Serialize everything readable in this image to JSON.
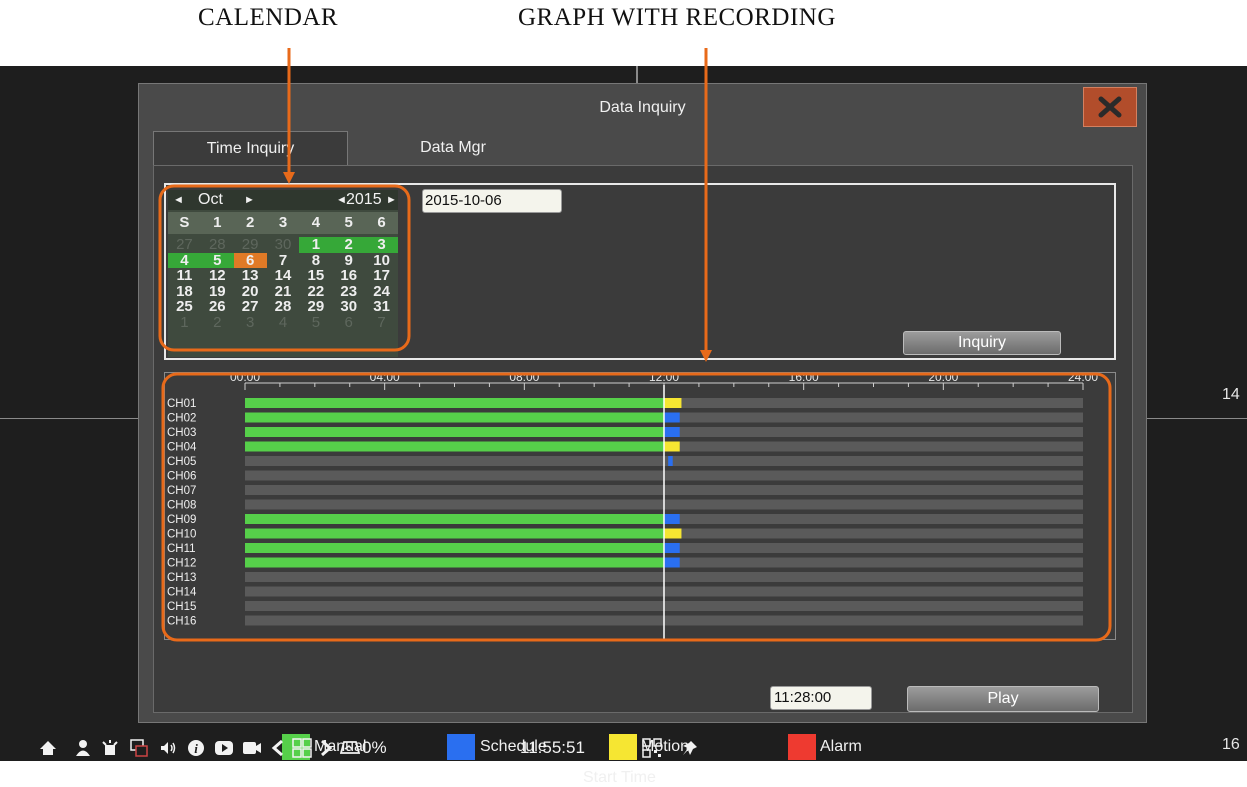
{
  "annotations": {
    "calendar": "CALENDAR",
    "graph": "GRAPH WITH RECORDING"
  },
  "side_numbers": {
    "right_mid": "14",
    "right_bottom": "16"
  },
  "dialog": {
    "title": "Data Inquiry",
    "tabs": [
      {
        "label": "Time Inquiry",
        "active": true
      },
      {
        "label": "Data Mgr",
        "active": false
      }
    ],
    "date_value": "2015-10-06",
    "inquiry_label": "Inquiry",
    "calendar": {
      "month": "Oct",
      "year": "2015",
      "weekdays": [
        "S",
        "1",
        "2",
        "3",
        "4",
        "5",
        "6"
      ],
      "weeks": [
        [
          {
            "d": "27",
            "s": "other"
          },
          {
            "d": "28",
            "s": "other"
          },
          {
            "d": "29",
            "s": "other"
          },
          {
            "d": "30",
            "s": "other"
          },
          {
            "d": "1",
            "s": "rec"
          },
          {
            "d": "2",
            "s": "rec"
          },
          {
            "d": "3",
            "s": "rec"
          }
        ],
        [
          {
            "d": "4",
            "s": "rec"
          },
          {
            "d": "5",
            "s": "rec"
          },
          {
            "d": "6",
            "s": "today"
          },
          {
            "d": "7",
            "s": ""
          },
          {
            "d": "8",
            "s": ""
          },
          {
            "d": "9",
            "s": ""
          },
          {
            "d": "10",
            "s": ""
          }
        ],
        [
          {
            "d": "11",
            "s": ""
          },
          {
            "d": "12",
            "s": ""
          },
          {
            "d": "13",
            "s": ""
          },
          {
            "d": "14",
            "s": ""
          },
          {
            "d": "15",
            "s": ""
          },
          {
            "d": "16",
            "s": ""
          },
          {
            "d": "17",
            "s": ""
          }
        ],
        [
          {
            "d": "18",
            "s": ""
          },
          {
            "d": "19",
            "s": ""
          },
          {
            "d": "20",
            "s": ""
          },
          {
            "d": "21",
            "s": ""
          },
          {
            "d": "22",
            "s": ""
          },
          {
            "d": "23",
            "s": ""
          },
          {
            "d": "24",
            "s": ""
          }
        ],
        [
          {
            "d": "25",
            "s": ""
          },
          {
            "d": "26",
            "s": ""
          },
          {
            "d": "27",
            "s": ""
          },
          {
            "d": "28",
            "s": ""
          },
          {
            "d": "29",
            "s": ""
          },
          {
            "d": "30",
            "s": ""
          },
          {
            "d": "31",
            "s": ""
          }
        ],
        [
          {
            "d": "1",
            "s": "other"
          },
          {
            "d": "2",
            "s": "other"
          },
          {
            "d": "3",
            "s": "other"
          },
          {
            "d": "4",
            "s": "other"
          },
          {
            "d": "5",
            "s": "other"
          },
          {
            "d": "6",
            "s": "other"
          },
          {
            "d": "7",
            "s": "other"
          }
        ]
      ]
    },
    "timeline": {
      "hour_labels": [
        "00:00",
        "04:00",
        "08:00",
        "12:00",
        "16:00",
        "20:00",
        "24:00"
      ],
      "cursor_hour": 12.0,
      "channels": [
        {
          "name": "CH01",
          "segments": [
            {
              "start": 0,
              "end": 12.0,
              "type": "manual"
            },
            {
              "start": 12.0,
              "end": 12.5,
              "type": "motion"
            }
          ]
        },
        {
          "name": "CH02",
          "segments": [
            {
              "start": 0,
              "end": 12.0,
              "type": "manual"
            },
            {
              "start": 12.0,
              "end": 12.45,
              "type": "schedule"
            }
          ]
        },
        {
          "name": "CH03",
          "segments": [
            {
              "start": 0,
              "end": 12.0,
              "type": "manual"
            },
            {
              "start": 12.0,
              "end": 12.45,
              "type": "schedule"
            }
          ]
        },
        {
          "name": "CH04",
          "segments": [
            {
              "start": 0,
              "end": 12.0,
              "type": "manual"
            },
            {
              "start": 12.0,
              "end": 12.45,
              "type": "motion"
            }
          ]
        },
        {
          "name": "CH05",
          "segments": [
            {
              "start": 12.12,
              "end": 12.25,
              "type": "schedule"
            }
          ]
        },
        {
          "name": "CH06",
          "segments": []
        },
        {
          "name": "CH07",
          "segments": []
        },
        {
          "name": "CH08",
          "segments": []
        },
        {
          "name": "CH09",
          "segments": [
            {
              "start": 0,
              "end": 12.0,
              "type": "manual"
            },
            {
              "start": 12.0,
              "end": 12.45,
              "type": "schedule"
            }
          ]
        },
        {
          "name": "CH10",
          "segments": [
            {
              "start": 0,
              "end": 12.0,
              "type": "manual"
            },
            {
              "start": 12.0,
              "end": 12.5,
              "type": "motion"
            }
          ]
        },
        {
          "name": "CH11",
          "segments": [
            {
              "start": 0,
              "end": 12.0,
              "type": "manual"
            },
            {
              "start": 12.0,
              "end": 12.45,
              "type": "schedule"
            }
          ]
        },
        {
          "name": "CH12",
          "segments": [
            {
              "start": 0,
              "end": 12.0,
              "type": "manual"
            },
            {
              "start": 12.0,
              "end": 12.45,
              "type": "schedule"
            }
          ]
        },
        {
          "name": "CH13",
          "segments": []
        },
        {
          "name": "CH14",
          "segments": []
        },
        {
          "name": "CH15",
          "segments": []
        },
        {
          "name": "CH16",
          "segments": []
        }
      ]
    },
    "legend": [
      {
        "label": "Manual",
        "color": "#56d04a"
      },
      {
        "label": "Schedule",
        "color": "#2a6ff0"
      },
      {
        "label": "Motion",
        "color": "#f6e632"
      },
      {
        "label": "Alarm",
        "color": "#ee3a30"
      }
    ],
    "start_time_label": "Start Time",
    "start_time_value": "11:28:00",
    "play_label": "Play"
  },
  "taskbar": {
    "disk_usage": "0%",
    "clock": "11:55:51"
  },
  "colors": {
    "manual": "#56d04a",
    "schedule": "#2a6ff0",
    "motion": "#f6e632",
    "alarm": "#ee3a30",
    "empty_track": "#5a5a5a",
    "annotation_orange": "#e86a1a",
    "close_red": "#b24d2b"
  }
}
